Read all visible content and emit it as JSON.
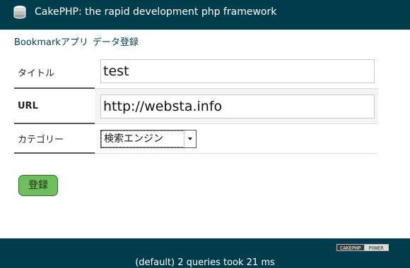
{
  "header": {
    "logo_icon": "cakephp-logo-icon",
    "title": "CakePHP: the rapid development php framework"
  },
  "breadcrumb": {
    "app": "Bookmarkアプリ",
    "page": "データ登録"
  },
  "form": {
    "fields": [
      {
        "label": "タイトル",
        "value": "test"
      },
      {
        "label": "URL",
        "value": "http://websta.info"
      },
      {
        "label": "カテゴリー",
        "selected": "検索エンジン"
      }
    ],
    "submit_label": "登録"
  },
  "footer": {
    "badge_left": "CAKEPHP",
    "badge_right": "POWER",
    "sql_log": "(default) 2 queries took 21 ms"
  },
  "colors": {
    "header_bg": "#003d4c",
    "submit_bg": "#6ebd5f"
  }
}
